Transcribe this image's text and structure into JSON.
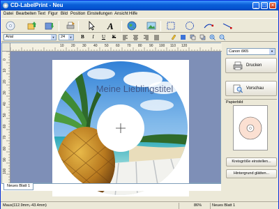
{
  "window": {
    "title": "CD-LabelPrint - Neu"
  },
  "menu": [
    "Datei",
    "Bearbeiten",
    "Text",
    "Figur",
    "Bild",
    "Position",
    "Einstellungen",
    "Ansicht",
    "Hilfe"
  ],
  "toolbar": {
    "icons": [
      "cd-icon",
      "open-icon",
      "save-icon",
      "print-icon",
      "pointer-icon",
      "text-icon",
      "globe-icon",
      "image-icon",
      "rect-icon",
      "circle-icon",
      "arc-icon",
      "line-icon"
    ]
  },
  "format": {
    "font": "Arial",
    "size": "24",
    "bold": "B",
    "italic": "I",
    "underline": "U",
    "strike": "K"
  },
  "canvas": {
    "label_text": "Meine Lieblingstitel",
    "ruler_h": [
      "10",
      "20",
      "30",
      "40",
      "50",
      "60",
      "70",
      "80",
      "90",
      "100",
      "110",
      "120"
    ],
    "ruler_v": [
      "0",
      "10",
      "20",
      "30",
      "40",
      "50",
      "60",
      "70",
      "80",
      "90",
      "100",
      "110"
    ]
  },
  "tab": {
    "label": "Neues Blatt 1"
  },
  "panel": {
    "printer": "Canon i965",
    "print_button": "Drucken",
    "preview_button": "Vorschau",
    "paper_label": "Papierbild",
    "circle_button": "Kreisgröße einstellen...",
    "background_button": "Hintergrund glätten..."
  },
  "status": {
    "coords": "Maus(112.9mm,-43.4mm)",
    "zoom": "86%",
    "sheet": "Neues Blatt 1"
  }
}
